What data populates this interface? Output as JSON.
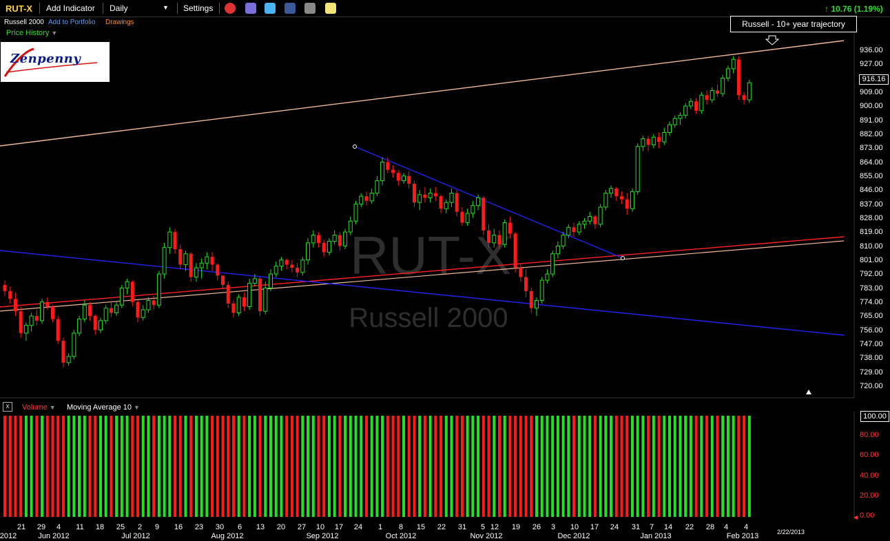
{
  "toolbar": {
    "symbol": "RUT-X",
    "add_indicator": "Add Indicator",
    "interval": "Daily",
    "settings": "Settings",
    "change": "10.76 (1.19%)"
  },
  "subbar": {
    "name": "Russell 2000",
    "add_to_portfolio": "Add to Portfolio",
    "drawings": "Drawings",
    "price_history": "Price History"
  },
  "logo": {
    "text": "Zenpenny"
  },
  "watermark": {
    "symbol": "RUT-X",
    "name": "Russell 2000"
  },
  "annotation": {
    "text": "Russell - 10+ year trajectory"
  },
  "last_price": "916.16",
  "price_axis": [
    "936.00",
    "927.00",
    "918.00",
    "909.00",
    "900.00",
    "891.00",
    "882.00",
    "873.00",
    "864.00",
    "855.00",
    "846.00",
    "837.00",
    "828.00",
    "819.00",
    "810.00",
    "801.00",
    "792.00",
    "783.00",
    "774.00",
    "765.00",
    "756.00",
    "747.00",
    "738.00",
    "729.00",
    "720.00"
  ],
  "volume_panel": {
    "close": "x",
    "label": "Volume",
    "ma_label": "Moving Average 10",
    "current": "100.00",
    "axis": [
      "80.00",
      "60.00",
      "40.00",
      "20.00",
      "0.00"
    ]
  },
  "x_axis": {
    "days": [
      "21",
      "29",
      "4",
      "11",
      "18",
      "25",
      "2",
      "9",
      "16",
      "23",
      "30",
      "6",
      "13",
      "20",
      "27",
      "10",
      "17",
      "24",
      "1",
      "8",
      "15",
      "22",
      "31",
      "5",
      "12",
      "19",
      "26",
      "3",
      "10",
      "17",
      "24",
      "31",
      "7",
      "14",
      "22",
      "28",
      "4",
      "4"
    ],
    "months": [
      "2012",
      "Jun 2012",
      "Jul 2012",
      "Aug 2012",
      "Sep 2012",
      "Oct 2012",
      "Nov 2012",
      "Dec 2012",
      "Jan 2013",
      "Feb 2013"
    ],
    "end_date": "2/22/2013"
  },
  "colors": {
    "up": "#22e022",
    "down": "#ff1a1a",
    "trend_blue": "#2222ee",
    "trend_peach": "#f0b89a"
  },
  "chart_data": {
    "type": "candlestick",
    "ylim": [
      720,
      940
    ],
    "x_start": "2012-05-15",
    "ohlc": [
      [
        786,
        789,
        779,
        782
      ],
      [
        782,
        785,
        774,
        777
      ],
      [
        777,
        781,
        766,
        769
      ],
      [
        769,
        772,
        752,
        755
      ],
      [
        755,
        762,
        750,
        760
      ],
      [
        760,
        768,
        756,
        766
      ],
      [
        766,
        770,
        760,
        763
      ],
      [
        763,
        777,
        761,
        775
      ],
      [
        775,
        778,
        770,
        772
      ],
      [
        772,
        773,
        762,
        764
      ],
      [
        764,
        766,
        748,
        750
      ],
      [
        750,
        752,
        733,
        736
      ],
      [
        736,
        742,
        734,
        740
      ],
      [
        740,
        757,
        738,
        755
      ],
      [
        755,
        766,
        753,
        764
      ],
      [
        764,
        776,
        762,
        773
      ],
      [
        773,
        775,
        763,
        766
      ],
      [
        766,
        767,
        754,
        757
      ],
      [
        757,
        765,
        755,
        763
      ],
      [
        763,
        773,
        761,
        771
      ],
      [
        771,
        776,
        765,
        768
      ],
      [
        768,
        775,
        766,
        773
      ],
      [
        773,
        786,
        771,
        784
      ],
      [
        784,
        790,
        780,
        788
      ],
      [
        788,
        789,
        772,
        775
      ],
      [
        775,
        776,
        762,
        765
      ],
      [
        765,
        773,
        763,
        770
      ],
      [
        770,
        778,
        768,
        776
      ],
      [
        776,
        779,
        770,
        773
      ],
      [
        773,
        795,
        771,
        793
      ],
      [
        793,
        813,
        790,
        810
      ],
      [
        810,
        823,
        806,
        820
      ],
      [
        820,
        822,
        806,
        809
      ],
      [
        809,
        812,
        796,
        799
      ],
      [
        799,
        808,
        795,
        806
      ],
      [
        806,
        807,
        788,
        791
      ],
      [
        791,
        800,
        788,
        797
      ],
      [
        797,
        803,
        790,
        800
      ],
      [
        800,
        807,
        796,
        804
      ],
      [
        804,
        807,
        795,
        799
      ],
      [
        799,
        800,
        789,
        792
      ],
      [
        792,
        790,
        783,
        786
      ],
      [
        786,
        788,
        771,
        774
      ],
      [
        774,
        776,
        765,
        768
      ],
      [
        768,
        780,
        766,
        778
      ],
      [
        778,
        781,
        769,
        772
      ],
      [
        772,
        790,
        770,
        787
      ],
      [
        787,
        793,
        785,
        790
      ],
      [
        790,
        791,
        766,
        769
      ],
      [
        769,
        788,
        767,
        784
      ],
      [
        784,
        796,
        782,
        793
      ],
      [
        793,
        801,
        791,
        798
      ],
      [
        798,
        804,
        795,
        802
      ],
      [
        802,
        803,
        796,
        799
      ],
      [
        799,
        802,
        794,
        797
      ],
      [
        797,
        800,
        791,
        794
      ],
      [
        794,
        804,
        792,
        802
      ],
      [
        802,
        816,
        799,
        813
      ],
      [
        813,
        821,
        810,
        818
      ],
      [
        818,
        820,
        810,
        813
      ],
      [
        813,
        815,
        804,
        807
      ],
      [
        807,
        816,
        805,
        814
      ],
      [
        814,
        821,
        812,
        818
      ],
      [
        818,
        820,
        808,
        811
      ],
      [
        811,
        822,
        809,
        820
      ],
      [
        820,
        830,
        818,
        827
      ],
      [
        827,
        840,
        825,
        838
      ],
      [
        838,
        845,
        836,
        843
      ],
      [
        843,
        846,
        837,
        840
      ],
      [
        840,
        848,
        838,
        845
      ],
      [
        845,
        856,
        843,
        853
      ],
      [
        853,
        868,
        850,
        865
      ],
      [
        865,
        868,
        858,
        860
      ],
      [
        860,
        863,
        855,
        858
      ],
      [
        858,
        860,
        850,
        853
      ],
      [
        853,
        858,
        851,
        856
      ],
      [
        856,
        859,
        848,
        851
      ],
      [
        851,
        853,
        836,
        839
      ],
      [
        839,
        847,
        834,
        844
      ],
      [
        844,
        849,
        839,
        842
      ],
      [
        842,
        848,
        839,
        845
      ],
      [
        845,
        849,
        840,
        843
      ],
      [
        843,
        844,
        832,
        835
      ],
      [
        835,
        841,
        832,
        839
      ],
      [
        839,
        848,
        836,
        845
      ],
      [
        845,
        847,
        830,
        833
      ],
      [
        833,
        836,
        824,
        826
      ],
      [
        826,
        835,
        824,
        832
      ],
      [
        832,
        840,
        829,
        837
      ],
      [
        837,
        844,
        834,
        842
      ],
      [
        842,
        843,
        818,
        821
      ],
      [
        821,
        825,
        810,
        813
      ],
      [
        813,
        822,
        810,
        818
      ],
      [
        818,
        821,
        809,
        812
      ],
      [
        812,
        828,
        810,
        826
      ],
      [
        826,
        830,
        816,
        819
      ],
      [
        819,
        820,
        794,
        797
      ],
      [
        797,
        800,
        788,
        791
      ],
      [
        791,
        796,
        778,
        782
      ],
      [
        782,
        784,
        768,
        771
      ],
      [
        771,
        778,
        766,
        776
      ],
      [
        776,
        791,
        774,
        789
      ],
      [
        789,
        796,
        787,
        793
      ],
      [
        793,
        808,
        791,
        806
      ],
      [
        806,
        814,
        803,
        811
      ],
      [
        811,
        820,
        809,
        818
      ],
      [
        818,
        825,
        816,
        823
      ],
      [
        823,
        826,
        817,
        820
      ],
      [
        820,
        827,
        818,
        825
      ],
      [
        825,
        829,
        822,
        827
      ],
      [
        827,
        833,
        825,
        830
      ],
      [
        830,
        831,
        822,
        825
      ],
      [
        825,
        838,
        823,
        836
      ],
      [
        836,
        847,
        834,
        845
      ],
      [
        845,
        850,
        842,
        848
      ],
      [
        848,
        849,
        840,
        843
      ],
      [
        843,
        846,
        838,
        841
      ],
      [
        841,
        845,
        831,
        835
      ],
      [
        835,
        848,
        833,
        846
      ],
      [
        846,
        877,
        844,
        875
      ],
      [
        875,
        882,
        872,
        880
      ],
      [
        880,
        882,
        872,
        876
      ],
      [
        876,
        883,
        874,
        881
      ],
      [
        881,
        884,
        874,
        878
      ],
      [
        878,
        887,
        876,
        884
      ],
      [
        884,
        891,
        882,
        889
      ],
      [
        889,
        895,
        887,
        893
      ],
      [
        893,
        897,
        889,
        895
      ],
      [
        895,
        903,
        893,
        901
      ],
      [
        901,
        906,
        899,
        904
      ],
      [
        904,
        906,
        896,
        898
      ],
      [
        898,
        910,
        896,
        908
      ],
      [
        908,
        911,
        902,
        905
      ],
      [
        905,
        913,
        903,
        911
      ],
      [
        911,
        915,
        907,
        909
      ],
      [
        909,
        921,
        907,
        919
      ],
      [
        919,
        927,
        917,
        925
      ],
      [
        925,
        933,
        922,
        931
      ],
      [
        931,
        933,
        905,
        908
      ],
      [
        908,
        910,
        902,
        905
      ],
      [
        905,
        918,
        903,
        916
      ]
    ]
  }
}
